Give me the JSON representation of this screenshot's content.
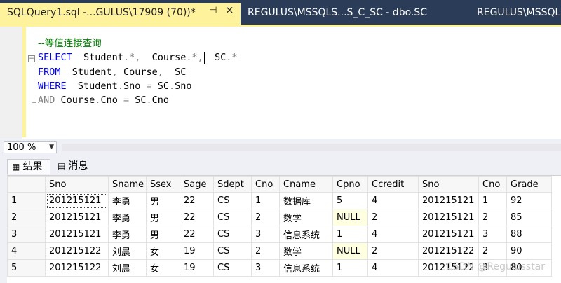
{
  "tabs": [
    {
      "label": "SQLQuery1.sql -...GULUS\\17909 (70))*",
      "active": true,
      "pin_icon": "pin-icon",
      "close_icon": "close-icon",
      "pin": "⊣",
      "close": "×"
    },
    {
      "label": "REGULUS\\MSSQLS...S_C_SC - dbo.SC",
      "active": false
    },
    {
      "label": "REGULUS\\MSSQLS",
      "active": false
    }
  ],
  "editor": {
    "lines": [
      [
        {
          "t": "--等值连接查询",
          "c": "cmt"
        }
      ],
      [
        {
          "t": "SELECT",
          "c": "kw"
        },
        {
          "t": "  Student",
          "c": "id"
        },
        {
          "t": ".*,",
          "c": "gr"
        },
        {
          "t": "  Course",
          "c": "id"
        },
        {
          "t": ".*,",
          "c": "gr"
        },
        {
          "t": "  SC",
          "c": "id"
        },
        {
          "t": ".*",
          "c": "gr"
        }
      ],
      [
        {
          "t": "FROM",
          "c": "kw"
        },
        {
          "t": "  Student",
          "c": "id"
        },
        {
          "t": ",",
          "c": "gr"
        },
        {
          "t": " Course",
          "c": "id"
        },
        {
          "t": ",",
          "c": "gr"
        },
        {
          "t": "  SC",
          "c": "id"
        }
      ],
      [
        {
          "t": "WHERE",
          "c": "kw"
        },
        {
          "t": "  Student",
          "c": "id"
        },
        {
          "t": ".",
          "c": "gr"
        },
        {
          "t": "Sno",
          "c": "id"
        },
        {
          "t": " = ",
          "c": "gr"
        },
        {
          "t": "SC",
          "c": "id"
        },
        {
          "t": ".",
          "c": "gr"
        },
        {
          "t": "Sno",
          "c": "id"
        }
      ],
      [
        {
          "t": "AND",
          "c": "gr"
        },
        {
          "t": " Course",
          "c": "id"
        },
        {
          "t": ".",
          "c": "gr"
        },
        {
          "t": "Cno",
          "c": "id"
        },
        {
          "t": " = ",
          "c": "gr"
        },
        {
          "t": "SC",
          "c": "id"
        },
        {
          "t": ".",
          "c": "gr"
        },
        {
          "t": "Cno",
          "c": "id"
        }
      ]
    ]
  },
  "zoom": {
    "value": "100 %",
    "arrow": "▼"
  },
  "results_tabs": {
    "results_label": "结果",
    "messages_label": "消息",
    "results_icon": "grid-icon",
    "messages_icon": "message-icon",
    "results_glyph": "▦",
    "messages_glyph": "▤"
  },
  "grid": {
    "columns": [
      "",
      "Sno",
      "Sname",
      "Ssex",
      "Sage",
      "Sdept",
      "Cno",
      "Cname",
      "Cpno",
      "Ccredit",
      "Sno",
      "Cno",
      "Grade"
    ],
    "rows": [
      [
        "1",
        "201215121",
        "李勇",
        "男",
        "22",
        "CS",
        "1",
        "数据库",
        "5",
        "4",
        "201215121",
        "1",
        "92"
      ],
      [
        "2",
        "201215121",
        "李勇",
        "男",
        "22",
        "CS",
        "2",
        "数学",
        "NULL",
        "2",
        "201215121",
        "2",
        "85"
      ],
      [
        "3",
        "201215121",
        "李勇",
        "男",
        "22",
        "CS",
        "3",
        "信息系统",
        "1",
        "4",
        "201215121",
        "3",
        "88"
      ],
      [
        "4",
        "201215122",
        "刘晨",
        "女",
        "19",
        "CS",
        "2",
        "数学",
        "NULL",
        "2",
        "201215122",
        "2",
        "90"
      ],
      [
        "5",
        "201215122",
        "刘晨",
        "女",
        "19",
        "CS",
        "3",
        "信息系统",
        "1",
        "4",
        "201215122",
        "3",
        "80"
      ]
    ]
  },
  "watermark": "CSDN @Regulusstar",
  "colors": {
    "tab_active": "#fff29d",
    "tabbar": "#2b3c58",
    "keyword": "#0000ff",
    "comment": "#008000",
    "null_cell": "#ffffe1"
  }
}
